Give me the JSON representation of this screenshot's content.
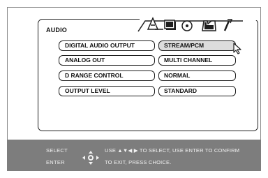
{
  "menu": {
    "tab_title": "AUDIO",
    "tabs": [
      {
        "icon": "speaker-a-icon",
        "selected": true
      },
      {
        "icon": "square-screen-icon",
        "selected": false
      },
      {
        "icon": "disc-icon",
        "selected": false
      },
      {
        "icon": "settings-gear-icon",
        "selected": false
      },
      {
        "icon": "wrench-icon",
        "selected": false
      }
    ]
  },
  "rows": [
    {
      "label": "DIGITAL AUDIO OUTPUT",
      "value": "STREAM/PCM",
      "selected": true
    },
    {
      "label": "ANALOG OUT",
      "value": "MULTI CHANNEL",
      "selected": false
    },
    {
      "label": "D RANGE CONTROL",
      "value": "NORMAL",
      "selected": false
    },
    {
      "label": "OUTPUT LEVEL",
      "value": "STANDARD",
      "selected": false
    }
  ],
  "footer": {
    "select_label": "SELECT",
    "enter_label": "ENTER",
    "hint_line1": "USE ▲▼◀ ▶ TO SELECT, USE ENTER TO CONFIRM",
    "hint_line2": "TO EXIT, PRESS CHOICE."
  },
  "colors": {
    "selected_value_bg": "#dcdcdc",
    "footer_bg": "#7d7d7d",
    "border": "#1e1e1e"
  }
}
